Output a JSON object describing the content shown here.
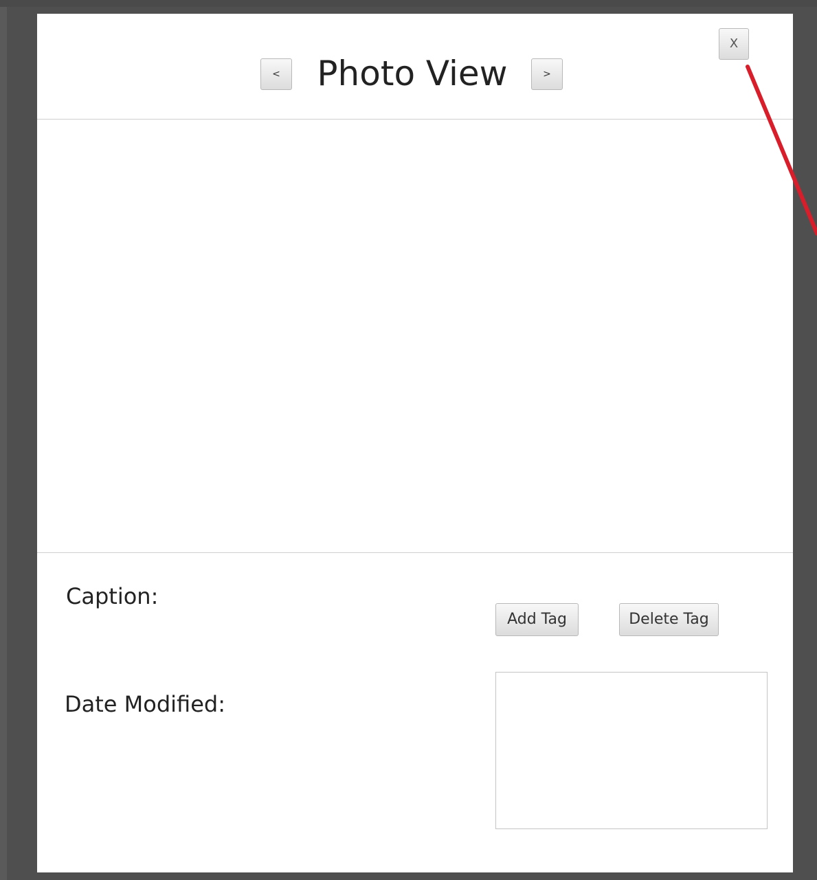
{
  "window": {
    "title": "Photo View",
    "prev_label": "<",
    "next_label": ">",
    "close_label": "X"
  },
  "details": {
    "caption_label": "Caption:",
    "date_label": "Date Modified:",
    "add_tag_label": "Add Tag",
    "delete_tag_label": "Delete Tag"
  },
  "colors": {
    "backdrop": "#4f4f4f",
    "annotation_arrow": "#d81e2a"
  },
  "icons": {
    "prev": "chevron-left-icon",
    "next": "chevron-right-icon",
    "annotation": "red-arrow-annotation"
  }
}
